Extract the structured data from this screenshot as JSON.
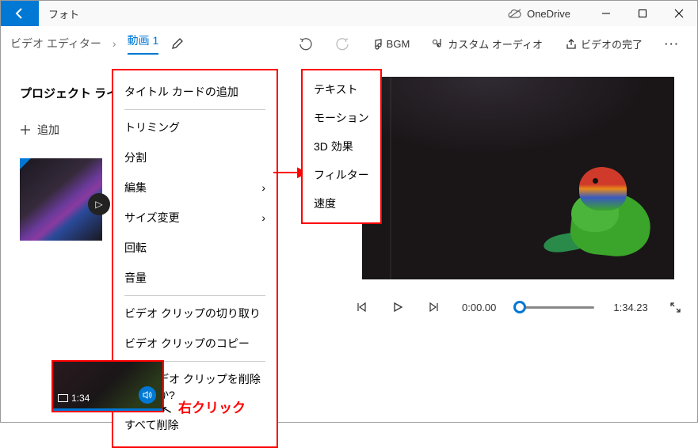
{
  "titlebar": {
    "app": "フォト",
    "onedrive": "OneDrive"
  },
  "toolbar": {
    "breadcrumb": "ビデオ エディター",
    "project": "動画 1",
    "bgm": "BGM",
    "custom_audio": "カスタム オーディオ",
    "finish": "ビデオの完了"
  },
  "library": {
    "title": "プロジェクト ライブラリ",
    "add": "追加"
  },
  "context_menu": {
    "add_title": "タイトル カードの追加",
    "trim": "トリミング",
    "split": "分割",
    "edit": "編集",
    "resize": "サイズ変更",
    "rotate": "回転",
    "volume": "音量",
    "cut": "ビデオ クリップの切り取り",
    "copy": "ビデオ クリップのコピー",
    "delete": "このビデオ クリップを削除しますか?",
    "delete_all": "すべて削除"
  },
  "submenu": {
    "text": "テキスト",
    "motion": "モーション",
    "effects": "3D 効果",
    "filter": "フィルター",
    "speed": "速度"
  },
  "transport": {
    "current": "0:00.00",
    "total": "1:34.23"
  },
  "storyboard": {
    "duration": "1:34"
  },
  "annotation": {
    "right_click": "右クリック"
  }
}
